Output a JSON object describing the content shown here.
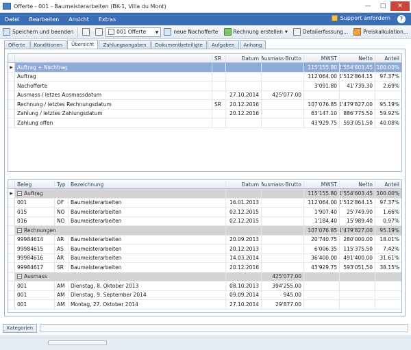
{
  "window": {
    "title": "Offerte - 001 - Baumeisterarbeiten (BK-1, Villa du Mont)"
  },
  "menu": {
    "items": [
      "Datei",
      "Bearbeiten",
      "Ansicht",
      "Extras"
    ],
    "support": "Support anfordern",
    "help": "?"
  },
  "toolbar": {
    "save": "Speichern und beenden",
    "select_value": "001 Offerte",
    "new_addendum": "neue Nachofferte",
    "create_invoice": "Rechnung erstellen",
    "detail": "Detailerfassung...",
    "price_calc": "Preiskalkulation..."
  },
  "tabs": [
    "Offerte",
    "Konditionen",
    "Übersicht",
    "Zahlungsangaben",
    "Dokumentbeteiligte",
    "Aufgaben",
    "Anhang"
  ],
  "summary": {
    "headers": [
      "SR",
      "Datum",
      "Ausmass Brutto",
      "MWST",
      "Netto",
      "Anteil"
    ],
    "rows": [
      {
        "label": "Auftrag + Nachtrag",
        "sr": "",
        "datum": "",
        "ausmass": "",
        "mwst": "115'155.80",
        "netto": "1'554'603.45",
        "anteil": "100.00%"
      },
      {
        "label": "Auftrag",
        "sr": "",
        "datum": "",
        "ausmass": "",
        "mwst": "112'064.00",
        "netto": "1'512'864.15",
        "anteil": "97.37%"
      },
      {
        "label": "Nachofferte",
        "sr": "",
        "datum": "",
        "ausmass": "",
        "mwst": "3'091.80",
        "netto": "41'739.30",
        "anteil": "2.69%"
      },
      {
        "label": "Ausmass / letzes Ausmassdatum",
        "sr": "",
        "datum": "27.10.2014",
        "ausmass": "425'077.00",
        "mwst": "",
        "netto": "",
        "anteil": ""
      },
      {
        "label": "Rechnung / letztes Rechnungsdatum",
        "sr": "SR",
        "datum": "20.12.2016",
        "ausmass": "",
        "mwst": "107'076.85",
        "netto": "1'479'827.00",
        "anteil": "95.19%"
      },
      {
        "label": "Zahlung / letztes Zahlungsdatum",
        "sr": "",
        "datum": "20.12.2016",
        "ausmass": "",
        "mwst": "63'147.10",
        "netto": "886'775.50",
        "anteil": "59.92%"
      },
      {
        "label": "Zahlung offen",
        "sr": "",
        "datum": "",
        "ausmass": "",
        "mwst": "43'929.75",
        "netto": "593'051.50",
        "anteil": "40.08%"
      }
    ]
  },
  "detail": {
    "headers": [
      "Beleg",
      "Typ",
      "Bezeichnung",
      "Datum",
      "Ausmass Brutto",
      "MWST",
      "Netto",
      "Anteil"
    ],
    "groups": [
      {
        "name": "Auftrag",
        "mwst": "115'155.80",
        "netto": "1'554'603.45",
        "anteil": "100.00%",
        "ausmass": "",
        "rows": [
          {
            "beleg": "001",
            "typ": "OF",
            "bez": "Baumeisterarbeiten",
            "datum": "16.01.2013",
            "ausmass": "",
            "mwst": "112'064.00",
            "netto": "1'512'864.15",
            "anteil": "97.37%"
          },
          {
            "beleg": "015",
            "typ": "NO",
            "bez": "Baumeisterarbeiten",
            "datum": "02.12.2015",
            "ausmass": "",
            "mwst": "1'907.40",
            "netto": "25'749.90",
            "anteil": "1.66%"
          },
          {
            "beleg": "016",
            "typ": "NO",
            "bez": "Baumeisterarbeiten",
            "datum": "02.12.2015",
            "ausmass": "",
            "mwst": "1'184.40",
            "netto": "15'989.40",
            "anteil": "0.97%"
          }
        ]
      },
      {
        "name": "Rechnungen",
        "mwst": "107'076.85",
        "netto": "1'479'827.00",
        "anteil": "95.19%",
        "ausmass": "",
        "rows": [
          {
            "beleg": "99984614",
            "typ": "AR",
            "bez": "Baumeisterarbeiten",
            "datum": "20.09.2013",
            "ausmass": "",
            "mwst": "20'740.75",
            "netto": "280'000.00",
            "anteil": "18.01%"
          },
          {
            "beleg": "99984615",
            "typ": "AS",
            "bez": "Baumeisterarbeiten",
            "datum": "20.12.2013",
            "ausmass": "",
            "mwst": "6'006.35",
            "netto": "115'375.50",
            "anteil": "7.42%"
          },
          {
            "beleg": "99984616",
            "typ": "AR",
            "bez": "Baumeisterarbeiten",
            "datum": "14.03.2014",
            "ausmass": "",
            "mwst": "36'400.00",
            "netto": "491'400.00",
            "anteil": "31.61%"
          },
          {
            "beleg": "99984617",
            "typ": "SR",
            "bez": "Baumeisterarbeiten",
            "datum": "20.12.2016",
            "ausmass": "",
            "mwst": "43'929.75",
            "netto": "593'051.50",
            "anteil": "38.15%"
          }
        ]
      },
      {
        "name": "Ausmass",
        "mwst": "",
        "netto": "",
        "anteil": "",
        "ausmass": "425'077.00",
        "rows": [
          {
            "beleg": "001",
            "typ": "AM",
            "bez": "Dienstag, 8. Oktober 2013",
            "datum": "08.10.2013",
            "ausmass": "394'255.00",
            "mwst": "",
            "netto": "",
            "anteil": ""
          },
          {
            "beleg": "001",
            "typ": "AM",
            "bez": "Dienstag, 9. September 2014",
            "datum": "09.09.2014",
            "ausmass": "945.00",
            "mwst": "",
            "netto": "",
            "anteil": ""
          },
          {
            "beleg": "001",
            "typ": "AM",
            "bez": "Montag, 27. Oktober 2014",
            "datum": "27.10.2014",
            "ausmass": "29'877.00",
            "mwst": "",
            "netto": "",
            "anteil": ""
          }
        ]
      }
    ]
  },
  "statusbar": {
    "categories": "Kategorien"
  }
}
